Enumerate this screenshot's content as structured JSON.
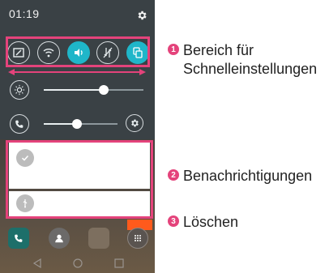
{
  "status_bar": {
    "time": "01:19",
    "settings_icon": "gear-icon"
  },
  "quick_settings": {
    "toggles": [
      {
        "icon": "screen-capture-icon",
        "state": "off"
      },
      {
        "icon": "wifi-icon",
        "state": "off"
      },
      {
        "icon": "sound-icon",
        "state": "on"
      },
      {
        "icon": "data-off-icon",
        "state": "off"
      },
      {
        "icon": "screen-share-icon",
        "state": "on"
      }
    ]
  },
  "sliders": {
    "brightness": {
      "icon": "brightness-icon",
      "level": 0.6
    },
    "volume": {
      "icon": "call-volume-icon",
      "level": 0.45,
      "settings_icon": "gear-icon"
    }
  },
  "notifications": [
    {
      "icon": "check-icon"
    },
    {
      "icon": "usb-icon"
    }
  ],
  "callouts": [
    {
      "number": "1",
      "label": "Bereich für Schnelleinstellungen"
    },
    {
      "number": "2",
      "label": "Benachrichtigungen"
    },
    {
      "number": "3",
      "label": "Löschen"
    }
  ],
  "colors": {
    "accent": "#1fb6c9",
    "highlight": "#e4437b",
    "clear_button": "#ff5a1c"
  }
}
